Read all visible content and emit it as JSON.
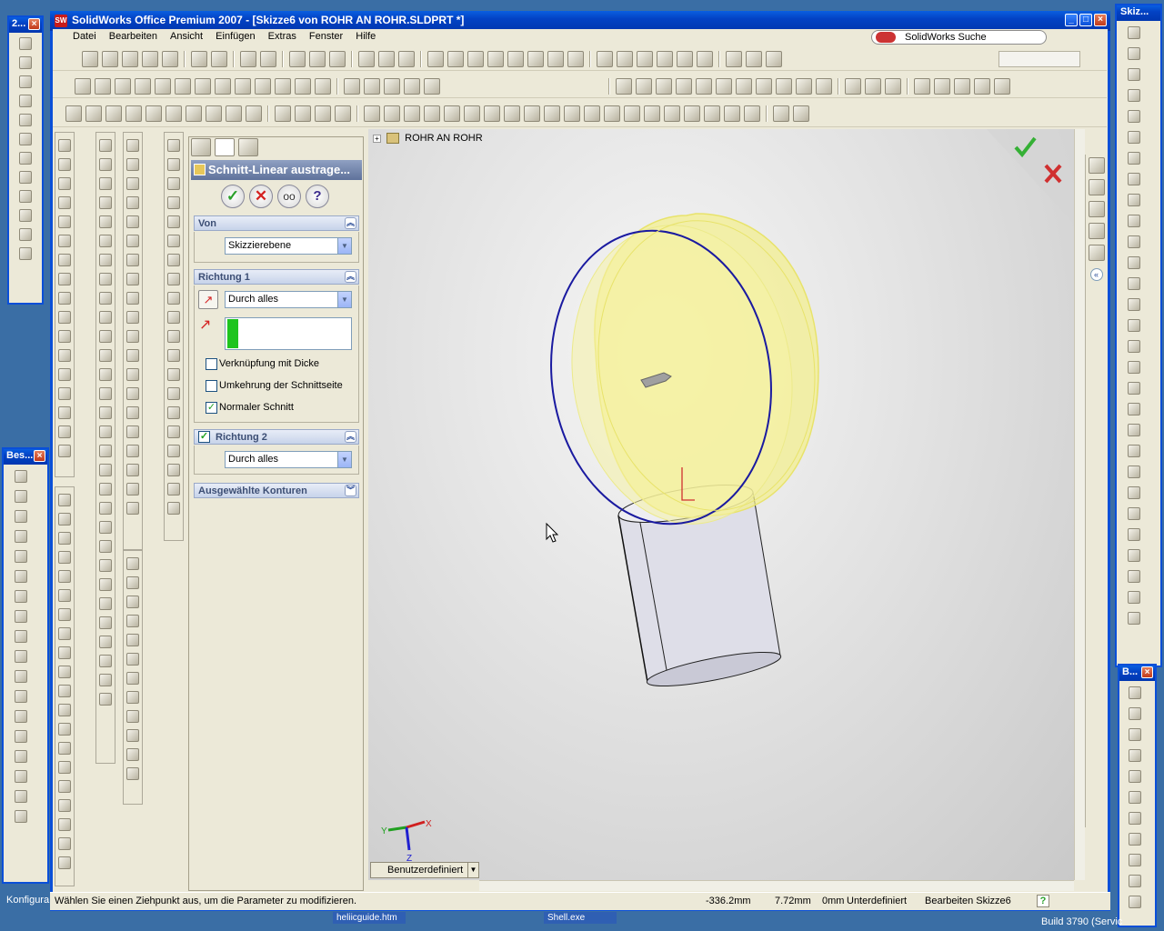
{
  "window": {
    "title": "SolidWorks Office Premium 2007 - [Skizze6 von ROHR AN ROHR.SLDPRT *]",
    "app_icon": "solidworks-logo"
  },
  "menu": {
    "items": [
      "Datei",
      "Bearbeiten",
      "Ansicht",
      "Einfügen",
      "Extras",
      "Fenster",
      "Hilfe"
    ],
    "search_label": "SolidWorks Suche"
  },
  "floating_panels": {
    "left_top_title": "2...",
    "left_bottom_title": "Bes...",
    "right_top_title": "Skiz...",
    "right_bottom_title": "B..."
  },
  "feature_tree": {
    "root_label": "ROHR AN ROHR"
  },
  "property_manager": {
    "title": "Schnitt-Linear austrage...",
    "buttons": [
      "OK",
      "Abbrechen",
      "Vorschau",
      "Hilfe"
    ],
    "von": {
      "header": "Von",
      "value": "Skizzierebene"
    },
    "richtung1": {
      "header": "Richtung 1",
      "end_condition": "Durch alles",
      "options": [
        {
          "label": "Verknüpfung mit Dicke",
          "checked": false
        },
        {
          "label": "Umkehrung der Schnittseite",
          "checked": false
        },
        {
          "label": "Normaler Schnitt",
          "checked": true
        }
      ]
    },
    "richtung2": {
      "header": "Richtung 2",
      "checked": true,
      "end_condition": "Durch alles"
    },
    "konturen": {
      "header": "Ausgewählte Konturen"
    }
  },
  "viewport": {
    "view_orientation": "Benutzerdefiniert",
    "triad_axes": [
      "X",
      "Y",
      "Z"
    ]
  },
  "status": {
    "hint": "Wählen Sie einen Ziehpunkt aus, um die Parameter zu modifizieren.",
    "x": "-336.2mm",
    "y": "7.72mm",
    "z": "0mm",
    "definition": "Unterdefiniert",
    "mode": "Bearbeiten Skizze6"
  },
  "taskbar_fragments": {
    "left": "Konfigura",
    "item1": "heliicguide.htm",
    "item2": "Shell.exe",
    "build": "Build 3790 (Servic"
  },
  "colors": {
    "viewport_bg": "#dcdcdc",
    "preview_yellow": "#f3f08a",
    "sketch_blue": "#1a1aa0",
    "accent_titlebar": "#0a4fd8"
  }
}
